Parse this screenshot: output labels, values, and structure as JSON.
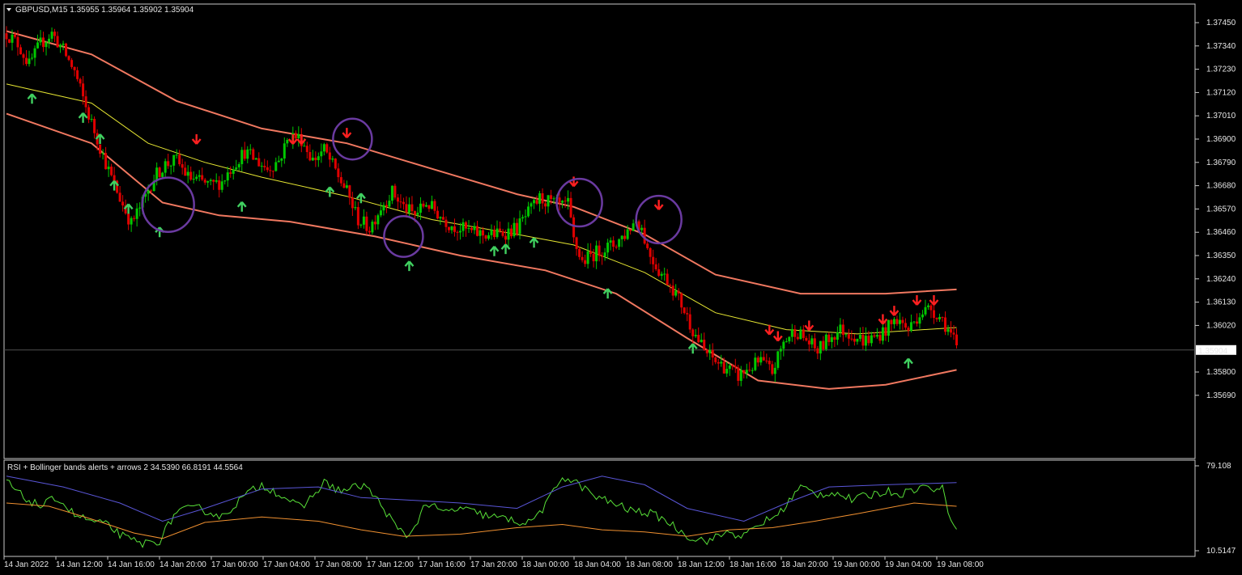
{
  "header": {
    "symbol_line": "GBPUSD,M15  1.35955 1.35964 1.35902 1.35904",
    "indicator_line": "RSI + Bollinger bands alerts + arrows 2 34.5390 66.8191 44.5564"
  },
  "colors": {
    "background": "#000000",
    "frame": "#c8c8c8",
    "bull": "#00c800",
    "bear": "#e00000",
    "band_outer": "#f07860",
    "band_mid": "#e6e632",
    "arrow_up": "#40d060",
    "arrow_down": "#ff2020",
    "circle": "#6a3aa0",
    "rsi": "#58e038",
    "rsi_upper": "#5a56d8",
    "rsi_lower": "#f09030",
    "price_tag_bg": "#ffffff",
    "price_tag_text": "#000000"
  },
  "chart_data": [
    {
      "type": "candlestick",
      "title": "GBPUSD,M15",
      "ylim": [
        1.3569,
        1.3755
      ],
      "y_ticks": [
        1.3745,
        1.3734,
        1.3723,
        1.3712,
        1.3701,
        1.369,
        1.3679,
        1.3668,
        1.3657,
        1.3646,
        1.3635,
        1.3624,
        1.3613,
        1.3602,
        1.358,
        1.3569
      ],
      "current_price": 1.35904,
      "x_ticks": [
        "14 Jan 2022",
        "14 Jan 12:00",
        "14 Jan 16:00",
        "14 Jan 20:00",
        "17 Jan 00:00",
        "17 Jan 04:00",
        "17 Jan 08:00",
        "17 Jan 12:00",
        "17 Jan 16:00",
        "17 Jan 20:00",
        "18 Jan 00:00",
        "18 Jan 04:00",
        "18 Jan 08:00",
        "18 Jan 12:00",
        "18 Jan 16:00",
        "18 Jan 20:00",
        "19 Jan 00:00",
        "19 Jan 04:00",
        "19 Jan 08:00"
      ],
      "close_path": [
        [
          0,
          1.374
        ],
        [
          4,
          1.3735
        ],
        [
          8,
          1.3725
        ],
        [
          12,
          1.3735
        ],
        [
          16,
          1.374
        ],
        [
          20,
          1.3732
        ],
        [
          24,
          1.3722
        ],
        [
          28,
          1.3705
        ],
        [
          32,
          1.369
        ],
        [
          36,
          1.3675
        ],
        [
          40,
          1.3662
        ],
        [
          44,
          1.365
        ],
        [
          48,
          1.366
        ],
        [
          52,
          1.3672
        ],
        [
          56,
          1.3678
        ],
        [
          60,
          1.368
        ],
        [
          64,
          1.3672
        ],
        [
          68,
          1.367
        ],
        [
          72,
          1.3668
        ],
        [
          76,
          1.367
        ],
        [
          80,
          1.3678
        ],
        [
          84,
          1.3684
        ],
        [
          88,
          1.368
        ],
        [
          92,
          1.3676
        ],
        [
          96,
          1.368
        ],
        [
          100,
          1.3692
        ],
        [
          104,
          1.369
        ],
        [
          108,
          1.368
        ],
        [
          112,
          1.3685
        ],
        [
          116,
          1.3675
        ],
        [
          120,
          1.3665
        ],
        [
          124,
          1.3652
        ],
        [
          128,
          1.3648
        ],
        [
          132,
          1.3658
        ],
        [
          136,
          1.3665
        ],
        [
          140,
          1.3658
        ],
        [
          144,
          1.3654
        ],
        [
          148,
          1.366
        ],
        [
          152,
          1.3655
        ],
        [
          156,
          1.365
        ],
        [
          160,
          1.3648
        ],
        [
          164,
          1.3646
        ],
        [
          168,
          1.3645
        ],
        [
          172,
          1.3645
        ],
        [
          176,
          1.3646
        ],
        [
          180,
          1.3648
        ],
        [
          184,
          1.3655
        ],
        [
          188,
          1.3662
        ],
        [
          192,
          1.366
        ],
        [
          196,
          1.3658
        ],
        [
          198,
          1.3659
        ],
        [
          200,
          1.3642
        ],
        [
          203,
          1.3632
        ],
        [
          206,
          1.3635
        ],
        [
          210,
          1.3638
        ],
        [
          214,
          1.364
        ],
        [
          218,
          1.3645
        ],
        [
          222,
          1.3652
        ],
        [
          224,
          1.3648
        ],
        [
          226,
          1.3638
        ],
        [
          230,
          1.3628
        ],
        [
          234,
          1.3622
        ],
        [
          238,
          1.3612
        ],
        [
          242,
          1.36
        ],
        [
          246,
          1.359
        ],
        [
          250,
          1.3585
        ],
        [
          254,
          1.3582
        ],
        [
          258,
          1.3578
        ],
        [
          262,
          1.3582
        ],
        [
          266,
          1.3585
        ],
        [
          270,
          1.358
        ],
        [
          274,
          1.3594
        ],
        [
          278,
          1.36
        ],
        [
          282,
          1.3595
        ],
        [
          286,
          1.359
        ],
        [
          290,
          1.3596
        ],
        [
          294,
          1.36
        ],
        [
          298,
          1.3598
        ],
        [
          302,
          1.3595
        ],
        [
          306,
          1.3596
        ],
        [
          310,
          1.36
        ],
        [
          314,
          1.3605
        ],
        [
          318,
          1.36
        ],
        [
          322,
          1.3608
        ],
        [
          326,
          1.361
        ],
        [
          330,
          1.3605
        ],
        [
          334,
          1.3595
        ],
        [
          335,
          1.35904
        ]
      ],
      "bands": {
        "upper": [
          [
            0,
            1.3741
          ],
          [
            30,
            1.373
          ],
          [
            60,
            1.3708
          ],
          [
            90,
            1.3695
          ],
          [
            120,
            1.3688
          ],
          [
            150,
            1.3676
          ],
          [
            180,
            1.3664
          ],
          [
            200,
            1.3658
          ],
          [
            225,
            1.3645
          ],
          [
            250,
            1.3626
          ],
          [
            280,
            1.3617
          ],
          [
            310,
            1.3617
          ],
          [
            335,
            1.3619
          ]
        ],
        "middle": [
          [
            0,
            1.3716
          ],
          [
            30,
            1.3707
          ],
          [
            50,
            1.3688
          ],
          [
            70,
            1.3679
          ],
          [
            90,
            1.3672
          ],
          [
            120,
            1.3663
          ],
          [
            150,
            1.3652
          ],
          [
            180,
            1.3645
          ],
          [
            200,
            1.364
          ],
          [
            225,
            1.3627
          ],
          [
            250,
            1.3608
          ],
          [
            275,
            1.36
          ],
          [
            300,
            1.3598
          ],
          [
            335,
            1.3601
          ]
        ],
        "lower": [
          [
            0,
            1.3702
          ],
          [
            30,
            1.3688
          ],
          [
            55,
            1.366
          ],
          [
            75,
            1.3654
          ],
          [
            100,
            1.3651
          ],
          [
            130,
            1.3644
          ],
          [
            160,
            1.3635
          ],
          [
            190,
            1.3628
          ],
          [
            215,
            1.3617
          ],
          [
            240,
            1.3596
          ],
          [
            265,
            1.3576
          ],
          [
            290,
            1.3572
          ],
          [
            310,
            1.3574
          ],
          [
            335,
            1.3581
          ]
        ]
      },
      "up_arrows": [
        [
          9,
          1.3709
        ],
        [
          27,
          1.37
        ],
        [
          33,
          1.369
        ],
        [
          38,
          1.3668
        ],
        [
          43,
          1.3657
        ],
        [
          54,
          1.3646
        ],
        [
          83,
          1.3658
        ],
        [
          114,
          1.3665
        ],
        [
          125,
          1.3662
        ],
        [
          142,
          1.363
        ],
        [
          172,
          1.3637
        ],
        [
          176,
          1.3638
        ],
        [
          186,
          1.3641
        ],
        [
          212,
          1.3617
        ],
        [
          242,
          1.3591
        ],
        [
          318,
          1.3584
        ]
      ],
      "down_arrows": [
        [
          67,
          1.369
        ],
        [
          101,
          1.369
        ],
        [
          104,
          1.369
        ],
        [
          120,
          1.3693
        ],
        [
          200,
          1.367
        ],
        [
          230,
          1.3659
        ],
        [
          269,
          1.36
        ],
        [
          272,
          1.3597
        ],
        [
          283,
          1.3602
        ],
        [
          309,
          1.3605
        ],
        [
          313,
          1.3609
        ],
        [
          321,
          1.3614
        ],
        [
          327,
          1.3614
        ]
      ],
      "circles": [
        [
          57,
          1.3659
        ],
        [
          122,
          1.369
        ],
        [
          140,
          1.3644
        ],
        [
          202,
          1.366
        ],
        [
          230,
          1.3652
        ]
      ]
    },
    {
      "type": "line",
      "title": "RSI + Bollinger bands alerts + arrows 2",
      "ylim": [
        10.5147,
        79.108
      ],
      "y_ticks": [
        79.108,
        10.5147
      ],
      "series": [
        {
          "name": "RSI",
          "values": [
            [
              0,
              75
            ],
            [
              6,
              60
            ],
            [
              12,
              52
            ],
            [
              18,
              60
            ],
            [
              24,
              44
            ],
            [
              30,
              38
            ],
            [
              36,
              34
            ],
            [
              42,
              22
            ],
            [
              48,
              17
            ],
            [
              54,
              20
            ],
            [
              60,
              48
            ],
            [
              68,
              50
            ],
            [
              76,
              42
            ],
            [
              84,
              62
            ],
            [
              90,
              72
            ],
            [
              96,
              64
            ],
            [
              104,
              50
            ],
            [
              112,
              74
            ],
            [
              118,
              66
            ],
            [
              126,
              72
            ],
            [
              132,
              54
            ],
            [
              138,
              30
            ],
            [
              142,
              24
            ],
            [
              148,
              55
            ],
            [
              154,
              46
            ],
            [
              160,
              50
            ],
            [
              168,
              44
            ],
            [
              176,
              40
            ],
            [
              184,
              36
            ],
            [
              190,
              52
            ],
            [
              196,
              80
            ],
            [
              202,
              72
            ],
            [
              208,
              60
            ],
            [
              214,
              55
            ],
            [
              220,
              48
            ],
            [
              226,
              46
            ],
            [
              232,
              40
            ],
            [
              238,
              28
            ],
            [
              242,
              22
            ],
            [
              248,
              20
            ],
            [
              254,
              28
            ],
            [
              260,
              24
            ],
            [
              266,
              36
            ],
            [
              272,
              44
            ],
            [
              280,
              70
            ],
            [
              286,
              63
            ],
            [
              292,
              65
            ],
            [
              298,
              58
            ],
            [
              304,
              62
            ],
            [
              310,
              66
            ],
            [
              316,
              64
            ],
            [
              322,
              70
            ],
            [
              330,
              68
            ],
            [
              333,
              40
            ],
            [
              335,
              34
            ]
          ]
        },
        {
          "name": "upper",
          "values": [
            [
              0,
              80
            ],
            [
              20,
              70
            ],
            [
              40,
              55
            ],
            [
              55,
              38
            ],
            [
              70,
              50
            ],
            [
              90,
              68
            ],
            [
              110,
              70
            ],
            [
              125,
              60
            ],
            [
              140,
              58
            ],
            [
              160,
              55
            ],
            [
              180,
              50
            ],
            [
              196,
              70
            ],
            [
              210,
              80
            ],
            [
              225,
              72
            ],
            [
              240,
              50
            ],
            [
              260,
              38
            ],
            [
              275,
              55
            ],
            [
              290,
              70
            ],
            [
              310,
              72
            ],
            [
              335,
              74
            ]
          ]
        },
        {
          "name": "lower",
          "values": [
            [
              0,
              55
            ],
            [
              15,
              52
            ],
            [
              30,
              40
            ],
            [
              45,
              27
            ],
            [
              55,
              22
            ],
            [
              70,
              37
            ],
            [
              90,
              42
            ],
            [
              110,
              38
            ],
            [
              125,
              30
            ],
            [
              140,
              24
            ],
            [
              160,
              26
            ],
            [
              180,
              32
            ],
            [
              196,
              35
            ],
            [
              210,
              30
            ],
            [
              225,
              28
            ],
            [
              240,
              24
            ],
            [
              255,
              30
            ],
            [
              270,
              32
            ],
            [
              285,
              38
            ],
            [
              300,
              45
            ],
            [
              320,
              55
            ],
            [
              335,
              52
            ]
          ]
        }
      ]
    }
  ]
}
